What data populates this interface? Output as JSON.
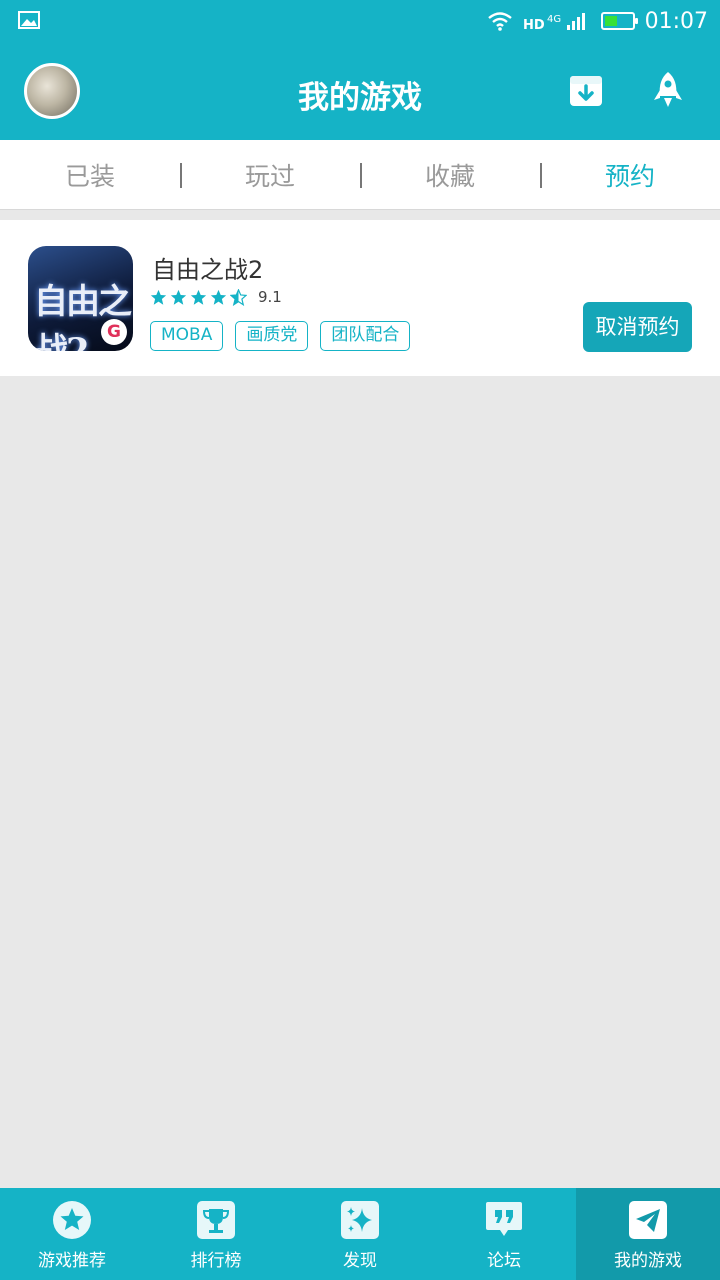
{
  "status_bar": {
    "time": "01:07",
    "network": "4G",
    "hd_label": "HD",
    "battery_level": 0.55,
    "battery_color": "#38e038",
    "left_icon": "image-icon",
    "icons": [
      "wifi-icon",
      "hd-4g-signal-icon",
      "battery-icon"
    ]
  },
  "header": {
    "title": "我的游戏",
    "avatar_icon": "avatar",
    "actions": [
      "download-icon",
      "rocket-icon"
    ]
  },
  "tabs": [
    {
      "label": "已装",
      "active": false
    },
    {
      "label": "玩过",
      "active": false
    },
    {
      "label": "收藏",
      "active": false
    },
    {
      "label": "预约",
      "active": true
    }
  ],
  "games": [
    {
      "name": "自由之战2",
      "rating": 4.5,
      "rating_value": "9.1",
      "tags": [
        "MOBA",
        "画质党",
        "团队配合"
      ],
      "action_label": "取消预约",
      "icon_text": "自由之战2",
      "icon_badge": "G"
    }
  ],
  "bottom_nav": [
    {
      "label": "游戏推荐",
      "icon": "star-icon",
      "active": false
    },
    {
      "label": "排行榜",
      "icon": "trophy-icon",
      "active": false
    },
    {
      "label": "发现",
      "icon": "sparkle-icon",
      "active": false
    },
    {
      "label": "论坛",
      "icon": "quote-bubble-icon",
      "active": false
    },
    {
      "label": "我的游戏",
      "icon": "paper-plane-icon",
      "active": true
    }
  ],
  "colors": {
    "accent": "#15b3c6",
    "accent_dark": "#129aaa",
    "button": "#15a6b8",
    "background": "#e8e8e8"
  }
}
